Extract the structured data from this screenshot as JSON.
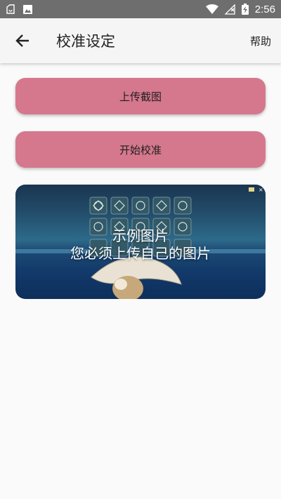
{
  "status_bar": {
    "time": "2:56",
    "icons": [
      "sync-icon",
      "image-icon",
      "wifi-icon",
      "signal-icon",
      "battery-charging-icon"
    ]
  },
  "app_bar": {
    "title": "校准设定",
    "help_label": "帮助",
    "back_icon": "arrow-back-icon"
  },
  "buttons": {
    "upload_label": "上传截图",
    "start_label": "开始校准"
  },
  "sample": {
    "line1": "示例图片",
    "line2": "您必须上传自己的图片"
  },
  "colors": {
    "accent_button": "#d5788d",
    "status_bar": "#6e6e6e",
    "app_bar": "#f5f5f5",
    "background": "#fafafa"
  }
}
